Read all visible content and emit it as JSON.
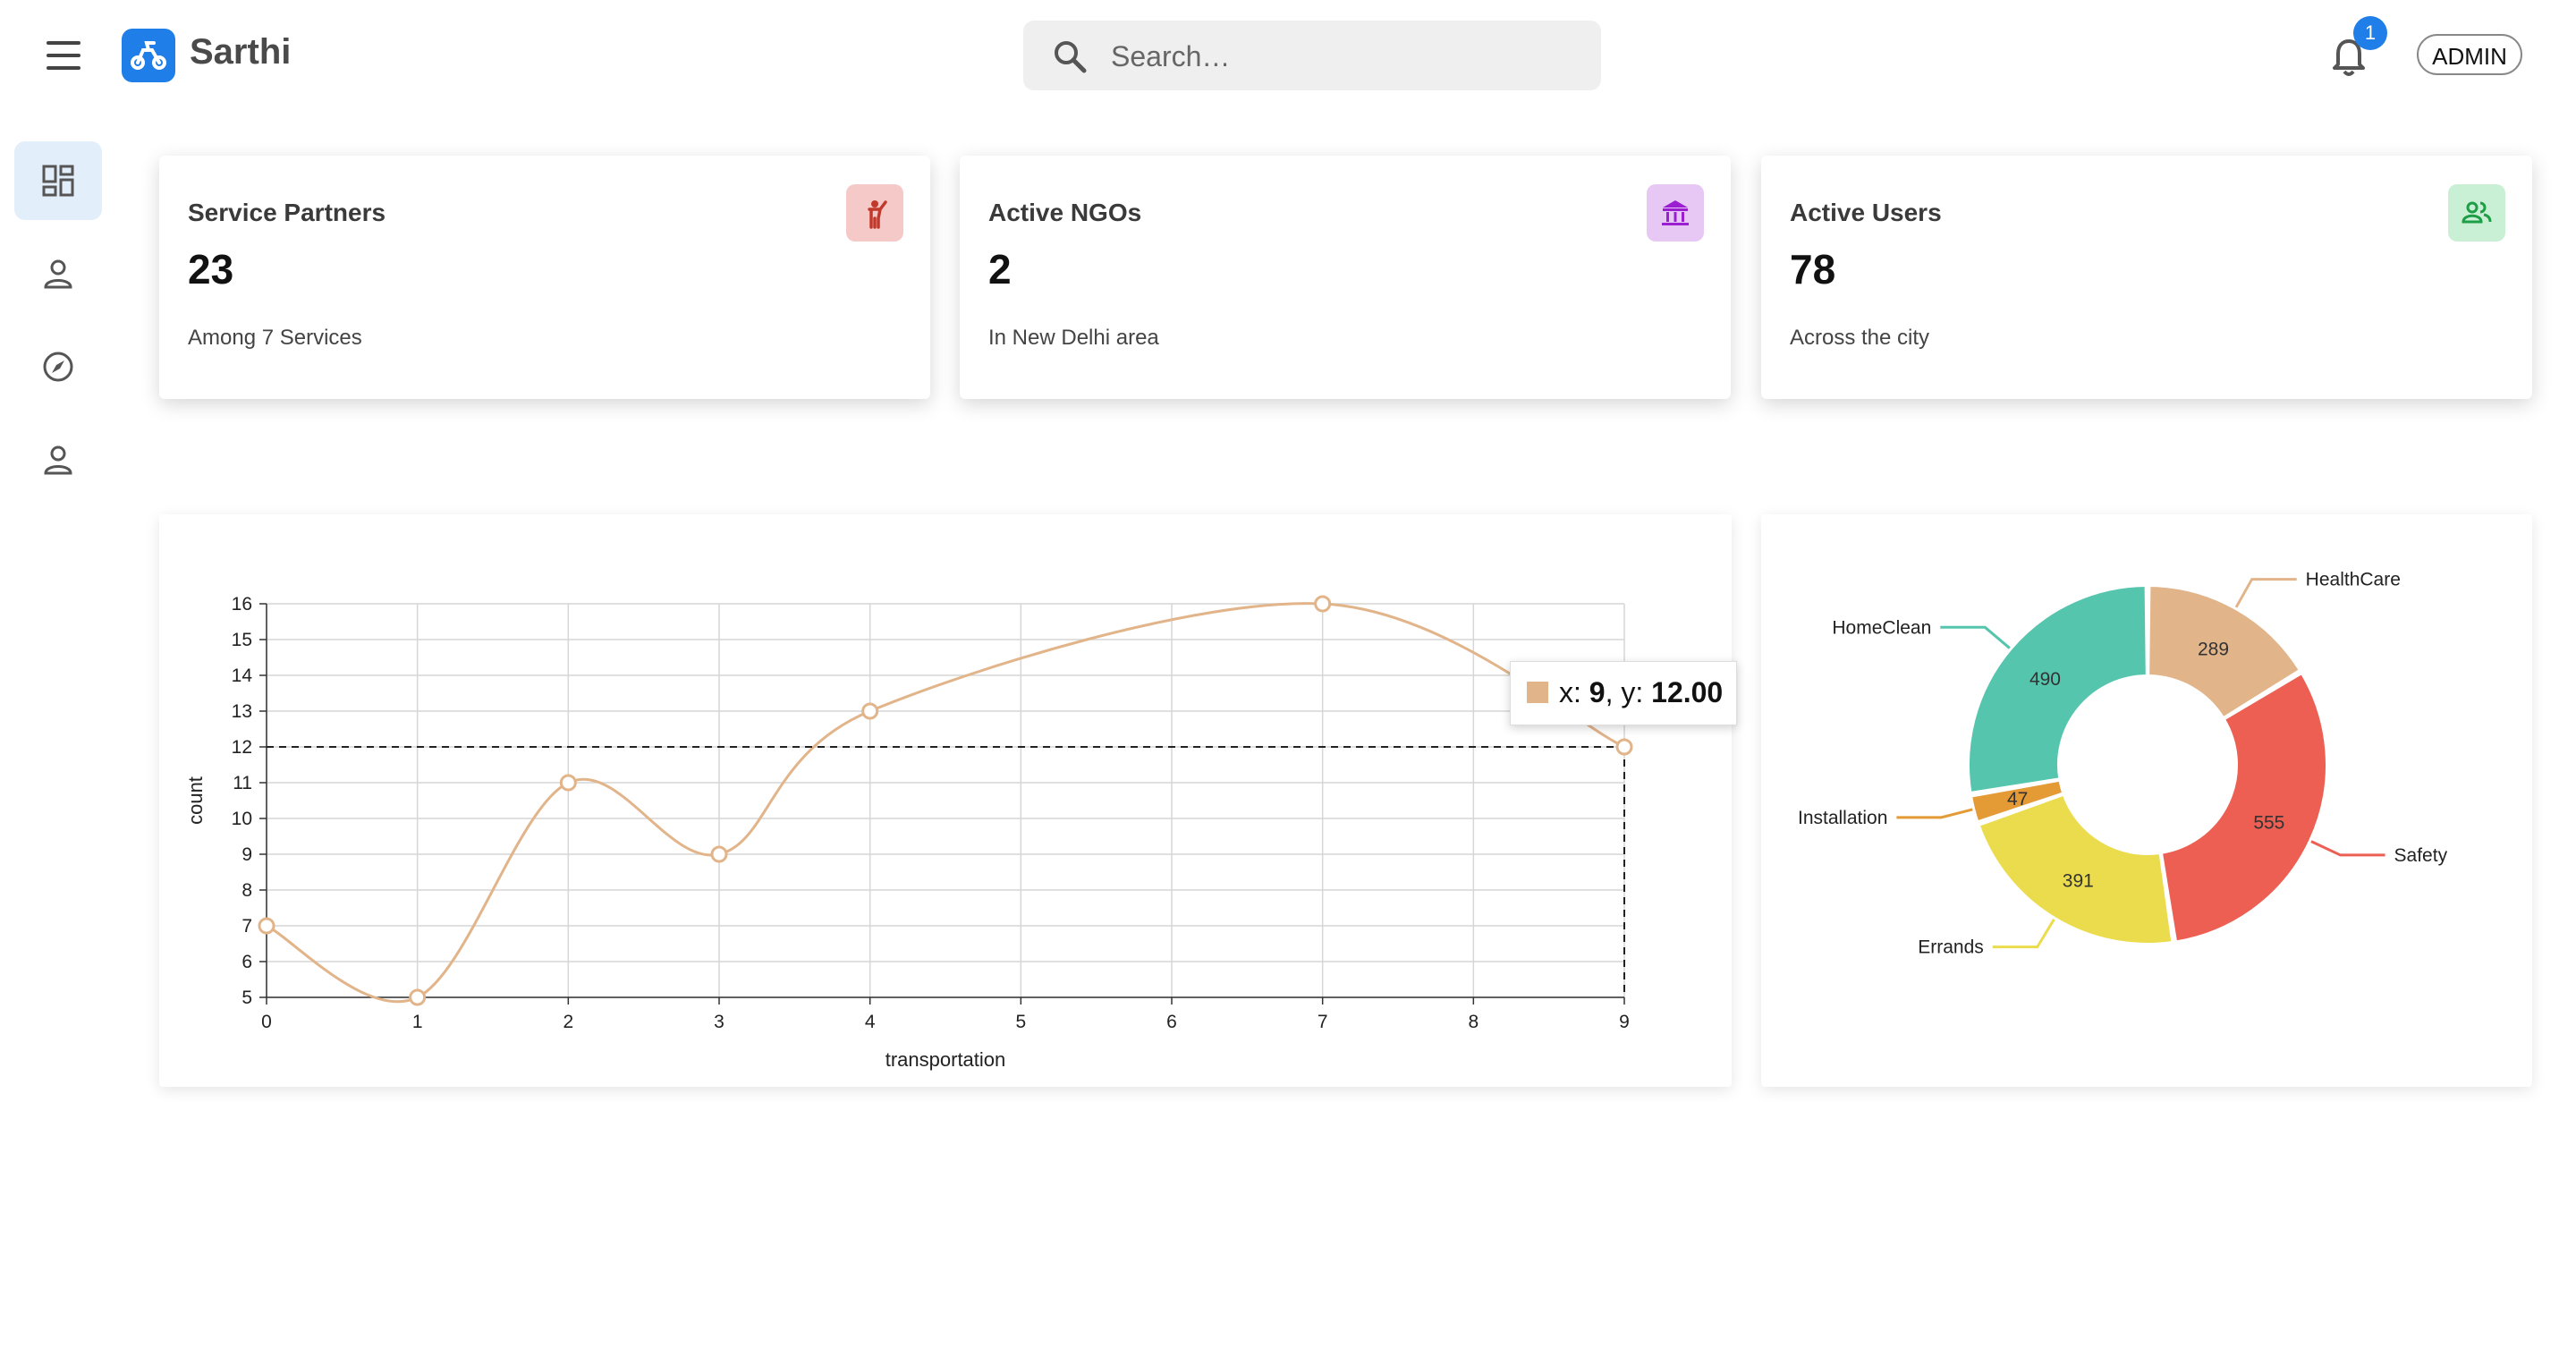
{
  "app": {
    "title": "Sarthi"
  },
  "search": {
    "placeholder": "Search…"
  },
  "notifications": {
    "count": "1"
  },
  "user": {
    "label": "ADMIN"
  },
  "sidebar": {
    "items": [
      {
        "icon": "dashboard-icon",
        "active": true
      },
      {
        "icon": "person-icon",
        "active": false
      },
      {
        "icon": "compass-icon",
        "active": false
      },
      {
        "icon": "person-icon",
        "active": false
      }
    ]
  },
  "stats": [
    {
      "title": "Service Partners",
      "value": "23",
      "sub": "Among 7 Services",
      "icon": "service-partner-icon",
      "color": "#f6c9c9"
    },
    {
      "title": "Active NGOs",
      "value": "2",
      "sub": "In New Delhi area",
      "icon": "institution-icon",
      "color": "#e7c8f5"
    },
    {
      "title": "Active Users",
      "value": "78",
      "sub": "Across the city",
      "icon": "users-icon",
      "color": "#c9f0d4"
    }
  ],
  "tooltip": {
    "x_label": "x: ",
    "x": "9",
    "sep": ", y: ",
    "y": "12.00"
  },
  "chart_data": [
    {
      "type": "line",
      "xlabel": "transportation",
      "ylabel": "count",
      "x": [
        0,
        1,
        2,
        3,
        4,
        7,
        9
      ],
      "y": [
        7,
        5,
        11,
        9,
        13,
        16,
        12
      ],
      "xticks": [
        0,
        1,
        2,
        3,
        4,
        5,
        6,
        7,
        8,
        9
      ],
      "yticks": [
        5,
        6,
        7,
        8,
        9,
        10,
        11,
        12,
        13,
        14,
        15,
        16
      ],
      "xlim": [
        0,
        9
      ],
      "ylim": [
        5,
        16
      ],
      "grid": true,
      "color": "#e2b48a",
      "crosshair": {
        "x": 9,
        "y": 12
      }
    },
    {
      "type": "pie",
      "donut": true,
      "labels": [
        "HealthCare",
        "Safety",
        "Errands",
        "Installation",
        "HomeClean"
      ],
      "values": [
        289,
        555,
        391,
        47,
        490
      ],
      "colors": [
        "#e2b48a",
        "#ec5f52",
        "#ebdc4d",
        "#e49a35",
        "#55c5ad"
      ]
    }
  ]
}
